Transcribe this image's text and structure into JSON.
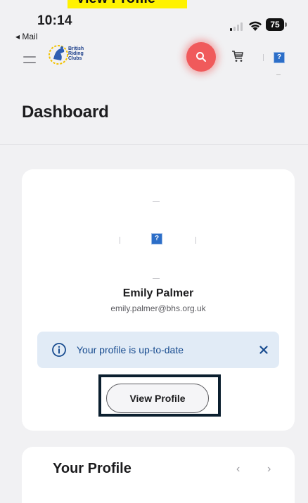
{
  "banner": {
    "text": "View Profile"
  },
  "status_bar": {
    "time": "10:14",
    "back_label": "◂ Mail",
    "battery": "75"
  },
  "header": {
    "logo_lines": [
      "British",
      "Riding",
      "Clubs"
    ],
    "avatar_placeholder": "?",
    "search_color": "#f05a5b"
  },
  "page": {
    "title": "Dashboard"
  },
  "profile_card": {
    "avatar_placeholder": "?",
    "name": "Emily Palmer",
    "email": "emily.palmer@bhs.org.uk",
    "notice_text": "Your profile is up-to-date",
    "view_profile_label": "View Profile"
  },
  "second_card": {
    "title": "Your Profile",
    "prev": "‹",
    "next": "›"
  },
  "colors": {
    "accent": "#174b8f",
    "notice_bg": "#e1ebf6",
    "highlight": "#fff200"
  }
}
